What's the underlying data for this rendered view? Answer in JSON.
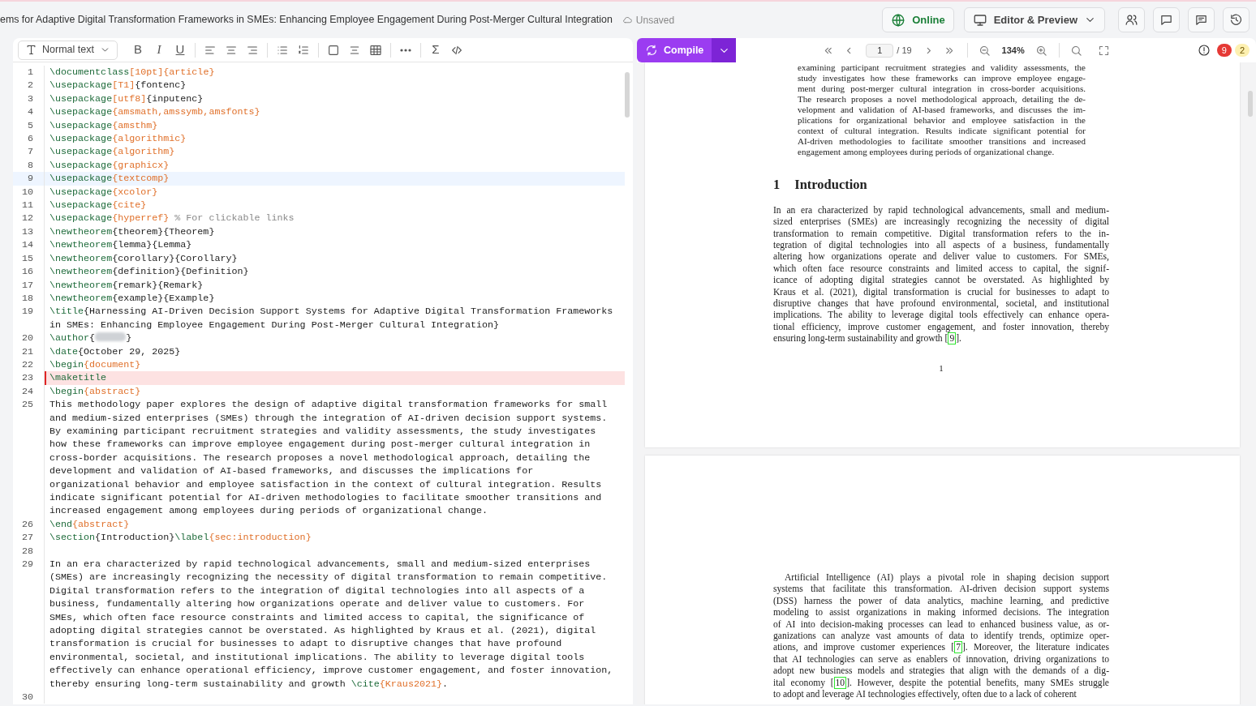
{
  "topbar": {
    "title": "ems for Adaptive Digital Transformation Frameworks in SMEs: Enhancing Employee Engagement During Post-Merger Cultural Integration",
    "save_status": "Unsaved",
    "online_label": "Online",
    "layout_label": "Editor & Preview"
  },
  "editor_toolbar": {
    "style_select": "Normal text",
    "tools": [
      {
        "kind": "bold",
        "text": "B"
      },
      {
        "kind": "italic",
        "text": "I"
      },
      {
        "kind": "underline",
        "text": "U"
      },
      {
        "kind": "divider"
      },
      {
        "kind": "align-left"
      },
      {
        "kind": "align-center"
      },
      {
        "kind": "align-right"
      },
      {
        "kind": "divider"
      },
      {
        "kind": "bullet-list"
      },
      {
        "kind": "numbered-list"
      },
      {
        "kind": "divider"
      },
      {
        "kind": "frame"
      },
      {
        "kind": "center-text"
      },
      {
        "kind": "table"
      },
      {
        "kind": "divider"
      },
      {
        "kind": "more"
      },
      {
        "kind": "divider"
      },
      {
        "kind": "symbol",
        "text": "Σ"
      },
      {
        "kind": "code"
      }
    ]
  },
  "code_lines": [
    {
      "number": "1",
      "active": false,
      "error": false,
      "parts": [
        {
          "kind": "command",
          "text": "\\documentclass"
        },
        {
          "kind": "arg",
          "text": "[10pt]{article}"
        }
      ]
    },
    {
      "number": "2",
      "active": false,
      "error": false,
      "parts": [
        {
          "kind": "command",
          "text": "\\usepackage"
        },
        {
          "kind": "arg",
          "text": "[T1]"
        },
        {
          "kind": "plain",
          "text": "{fontenc}"
        }
      ]
    },
    {
      "number": "3",
      "active": false,
      "error": false,
      "parts": [
        {
          "kind": "command",
          "text": "\\usepackage"
        },
        {
          "kind": "arg",
          "text": "[utf8]"
        },
        {
          "kind": "plain",
          "text": "{inputenc}"
        }
      ]
    },
    {
      "number": "4",
      "active": false,
      "error": false,
      "parts": [
        {
          "kind": "command",
          "text": "\\usepackage"
        },
        {
          "kind": "arg",
          "text": "{amsmath,amssymb,amsfonts}"
        }
      ]
    },
    {
      "number": "5",
      "active": false,
      "error": false,
      "parts": [
        {
          "kind": "command",
          "text": "\\usepackage"
        },
        {
          "kind": "arg",
          "text": "{amsthm}"
        }
      ]
    },
    {
      "number": "6",
      "active": false,
      "error": false,
      "parts": [
        {
          "kind": "command",
          "text": "\\usepackage"
        },
        {
          "kind": "arg",
          "text": "{algorithmic}"
        }
      ]
    },
    {
      "number": "7",
      "active": false,
      "error": false,
      "parts": [
        {
          "kind": "command",
          "text": "\\usepackage"
        },
        {
          "kind": "arg",
          "text": "{algorithm}"
        }
      ]
    },
    {
      "number": "8",
      "active": false,
      "error": false,
      "parts": [
        {
          "kind": "command",
          "text": "\\usepackage"
        },
        {
          "kind": "arg",
          "text": "{graphicx}"
        }
      ]
    },
    {
      "number": "9",
      "active": true,
      "error": false,
      "parts": [
        {
          "kind": "command",
          "text": "\\usepackage"
        },
        {
          "kind": "arg",
          "text": "{textcomp}"
        }
      ]
    },
    {
      "number": "10",
      "active": false,
      "error": false,
      "parts": [
        {
          "kind": "command",
          "text": "\\usepackage"
        },
        {
          "kind": "arg",
          "text": "{xcolor}"
        }
      ]
    },
    {
      "number": "11",
      "active": false,
      "error": false,
      "parts": [
        {
          "kind": "command",
          "text": "\\usepackage"
        },
        {
          "kind": "arg",
          "text": "{cite}"
        }
      ]
    },
    {
      "number": "12",
      "active": false,
      "error": false,
      "parts": [
        {
          "kind": "command",
          "text": "\\usepackage"
        },
        {
          "kind": "arg",
          "text": "{hyperref}"
        },
        {
          "kind": "comment",
          "text": " % For clickable links"
        }
      ]
    },
    {
      "number": "13",
      "active": false,
      "error": false,
      "parts": [
        {
          "kind": "command",
          "text": "\\newtheorem"
        },
        {
          "kind": "plain",
          "text": "{theorem}{Theorem}"
        }
      ]
    },
    {
      "number": "14",
      "active": false,
      "error": false,
      "parts": [
        {
          "kind": "command",
          "text": "\\newtheorem"
        },
        {
          "kind": "plain",
          "text": "{lemma}{Lemma}"
        }
      ]
    },
    {
      "number": "15",
      "active": false,
      "error": false,
      "parts": [
        {
          "kind": "command",
          "text": "\\newtheorem"
        },
        {
          "kind": "plain",
          "text": "{corollary}{Corollary}"
        }
      ]
    },
    {
      "number": "16",
      "active": false,
      "error": false,
      "parts": [
        {
          "kind": "command",
          "text": "\\newtheorem"
        },
        {
          "kind": "plain",
          "text": "{definition}{Definition}"
        }
      ]
    },
    {
      "number": "17",
      "active": false,
      "error": false,
      "parts": [
        {
          "kind": "command",
          "text": "\\newtheorem"
        },
        {
          "kind": "plain",
          "text": "{remark}{Remark}"
        }
      ]
    },
    {
      "number": "18",
      "active": false,
      "error": false,
      "parts": [
        {
          "kind": "command",
          "text": "\\newtheorem"
        },
        {
          "kind": "plain",
          "text": "{example}{Example}"
        }
      ]
    },
    {
      "number": "19",
      "active": false,
      "error": false,
      "parts": [
        {
          "kind": "command",
          "text": "\\title"
        },
        {
          "kind": "plain",
          "text": "{Harnessing AI-Driven Decision Support Systems for Adaptive Digital Transformation Frameworks in SMEs: Enhancing Employee Engagement During Post-Merger Cultural Integration}"
        }
      ]
    },
    {
      "number": "20",
      "active": false,
      "error": false,
      "parts": [
        {
          "kind": "command",
          "text": "\\author"
        },
        {
          "kind": "plain",
          "text": "{"
        },
        {
          "kind": "redacted"
        },
        {
          "kind": "plain",
          "text": "}"
        }
      ]
    },
    {
      "number": "21",
      "active": false,
      "error": false,
      "parts": [
        {
          "kind": "command",
          "text": "\\date"
        },
        {
          "kind": "plain",
          "text": "{October 29, 2025}"
        }
      ]
    },
    {
      "number": "22",
      "active": false,
      "error": false,
      "parts": [
        {
          "kind": "command",
          "text": "\\begin"
        },
        {
          "kind": "arg",
          "text": "{document}"
        }
      ]
    },
    {
      "number": "23",
      "active": false,
      "error": true,
      "parts": [
        {
          "kind": "command",
          "text": "\\maketitle"
        }
      ]
    },
    {
      "number": "24",
      "active": false,
      "error": false,
      "parts": [
        {
          "kind": "command",
          "text": "\\begin"
        },
        {
          "kind": "arg",
          "text": "{abstract}"
        }
      ]
    },
    {
      "number": "25",
      "active": false,
      "error": false,
      "parts": [
        {
          "kind": "plain",
          "text": "This methodology paper explores the design of adaptive digital transformation frameworks for small and medium-sized enterprises (SMEs) through the integration of AI-driven decision support systems. By examining participant recruitment strategies and validity assessments, the study investigates how these frameworks can improve employee engagement during post-merger cultural integration in cross-border acquisitions. The research proposes a novel methodological approach, detailing the development and validation of AI-based frameworks, and discusses the implications for organizational behavior and employee satisfaction in the context of cultural integration. Results indicate significant potential for AI-driven methodologies to facilitate smoother transitions and increased engagement among employees during periods of organizational change."
        }
      ]
    },
    {
      "number": "26",
      "active": false,
      "error": false,
      "parts": [
        {
          "kind": "command",
          "text": "\\end"
        },
        {
          "kind": "arg",
          "text": "{abstract}"
        }
      ]
    },
    {
      "number": "27",
      "active": false,
      "error": false,
      "parts": [
        {
          "kind": "command",
          "text": "\\section"
        },
        {
          "kind": "plain",
          "text": "{Introduction}"
        },
        {
          "kind": "command",
          "text": "\\label"
        },
        {
          "kind": "arg",
          "text": "{sec:introduction}"
        }
      ]
    },
    {
      "number": "28",
      "active": false,
      "error": false
    },
    {
      "number": "29",
      "active": false,
      "error": false,
      "parts": [
        {
          "kind": "plain",
          "text": "In an era characterized by rapid technological advancements, small and medium-sized enterprises (SMEs) are increasingly recognizing the necessity of digital transformation to remain competitive. Digital transformation refers to the integration of digital technologies into all aspects of a business, fundamentally altering how organizations operate and deliver value to customers. For SMEs, which often face resource constraints and limited access to capital, the significance of adopting digital strategies cannot be overstated. As highlighted by Kraus et al. (2021), digital transformation is crucial for businesses to adapt to disruptive changes that have profound environmental, societal, and institutional implications. The ability to leverage digital tools effectively can enhance operational efficiency, improve customer engagement, and foster innovation, thereby ensuring long-term sustainability and growth "
        },
        {
          "kind": "command",
          "text": "\\cite"
        },
        {
          "kind": "arg",
          "text": "{Kraus2021}"
        },
        {
          "kind": "plain",
          "text": "."
        }
      ]
    },
    {
      "number": "30",
      "active": false,
      "error": false
    }
  ],
  "pdf_toolbar": {
    "compile_label": "Compile",
    "page": "1",
    "page_total": "/ 19",
    "zoom": "134%",
    "error_count": "9",
    "warning_count": "2"
  },
  "pdf_pages": [
    {
      "blocks": [
        {
          "kind": "abstract",
          "lines": [
            "examining participant recruitment strategies and validity assessments, the",
            "study investigates how these frameworks can improve employee engage-",
            "ment during post-merger cultural integration in cross-border acquisitions.",
            "The research proposes a novel methodological approach, detailing the de-",
            "velopment and validation of AI-based frameworks, and discusses the im-",
            "plications for organizational behavior and employee satisfaction in the",
            "context of cultural integration. Results indicate significant potential for",
            "AI-driven methodologies to facilitate smoother transitions and increased",
            "engagement among employees during periods of organizational change."
          ]
        },
        {
          "kind": "heading",
          "number": "1",
          "title": "Introduction"
        },
        {
          "kind": "paragraph",
          "lines": [
            "In an era characterized by rapid technological advancements, small and medium-",
            "sized enterprises (SMEs) are increasingly recognizing the necessity of digital",
            "transformation to remain competitive. Digital transformation refers to the in-",
            "tegration of digital technologies into all aspects of a business, fundamentally",
            "altering how organizations operate and deliver value to customers. For SMEs,",
            "which often face resource constraints and limited access to capital, the signif-",
            "icance of adopting digital strategies cannot be overstated. As highlighted by",
            "Kraus et al. (2021), digital transformation is crucial for businesses to adapt to",
            "disruptive changes that have profound environmental, societal, and institutional",
            "implications. The ability to leverage digital tools effectively can enhance opera-",
            "tional efficiency, improve customer engagement, and foster innovation, thereby",
            {
              "parts": [
                "ensuring long-term sustainability and growth [",
                {
                  "link": "9"
                },
                "]."
              ]
            }
          ]
        },
        {
          "kind": "page-number",
          "text": "1"
        }
      ]
    },
    {
      "blocks": [
        {
          "kind": "indented-paragraph",
          "lines": [
            "Artificial Intelligence (AI) plays a pivotal role in shaping decision support",
            "systems that facilitate this transformation. AI-driven decision support systems",
            "(DSS) harness the power of data analytics, machine learning, and predictive",
            "modeling to assist organizations in making informed decisions. The integration",
            "of AI into decision-making processes can lead to enhanced business value, as or-",
            "ganizations can analyze vast amounts of data to identify trends, optimize oper-",
            {
              "parts": [
                "ations, and improve customer experiences [",
                {
                  "link": "7"
                },
                "]. Moreover, the literature indicates"
              ]
            },
            "that AI technologies can serve as enablers of innovation, driving organizations to",
            "adopt new business models and strategies that align with the demands of a dig-",
            {
              "parts": [
                "ital economy [",
                {
                  "link": "10"
                },
                "]. However, despite the potential benefits, many SMEs struggle"
              ]
            },
            "to adopt and leverage AI technologies effectively, often due to a lack of coherent"
          ]
        }
      ]
    }
  ]
}
